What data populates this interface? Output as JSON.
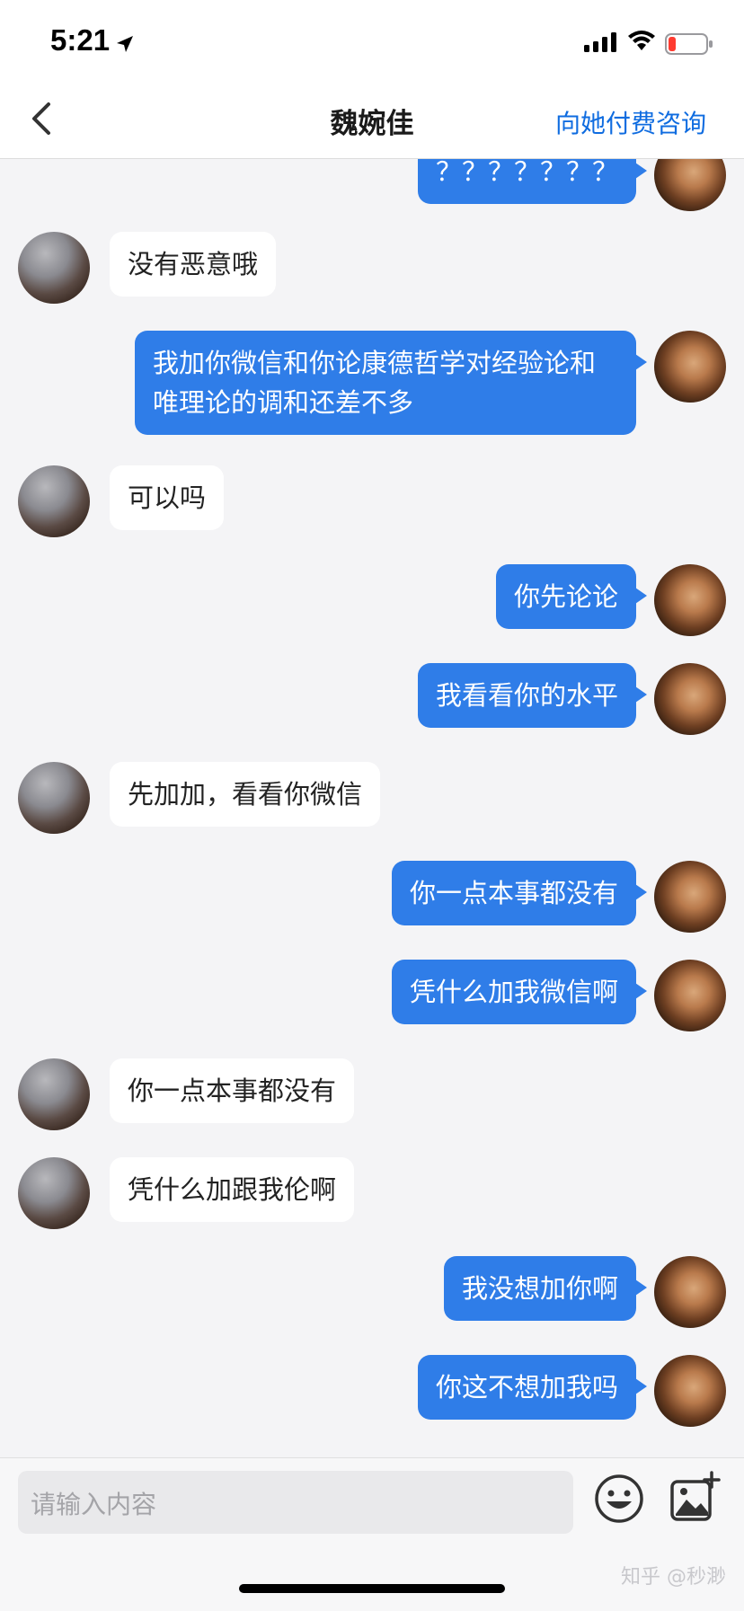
{
  "status": {
    "time": "5:21"
  },
  "nav": {
    "title": "魏婉佳",
    "action": "向她付费咨询"
  },
  "messages": [
    {
      "side": "self",
      "text": "？？？？？？？"
    },
    {
      "side": "other",
      "text": "没有恶意哦"
    },
    {
      "side": "self",
      "text": "我加你微信和你论康德哲学对经验论和唯理论的调和还差不多"
    },
    {
      "side": "other",
      "text": "可以吗"
    },
    {
      "side": "self",
      "text": "你先论论"
    },
    {
      "side": "self",
      "text": "我看看你的水平"
    },
    {
      "side": "other",
      "text": "先加加，看看你微信"
    },
    {
      "side": "self",
      "text": "你一点本事都没有"
    },
    {
      "side": "self",
      "text": "凭什么加我微信啊"
    },
    {
      "side": "other",
      "text": "你一点本事都没有"
    },
    {
      "side": "other",
      "text": "凭什么加跟我伦啊"
    },
    {
      "side": "self",
      "text": "我没想加你啊"
    },
    {
      "side": "self",
      "text": "你这不想加我吗"
    }
  ],
  "input": {
    "placeholder": "请输入内容"
  },
  "watermark": "知乎 @秒渺",
  "colors": {
    "self_bubble": "#2f7de8",
    "other_bubble": "#ffffff",
    "accent": "#0f6ce0"
  }
}
